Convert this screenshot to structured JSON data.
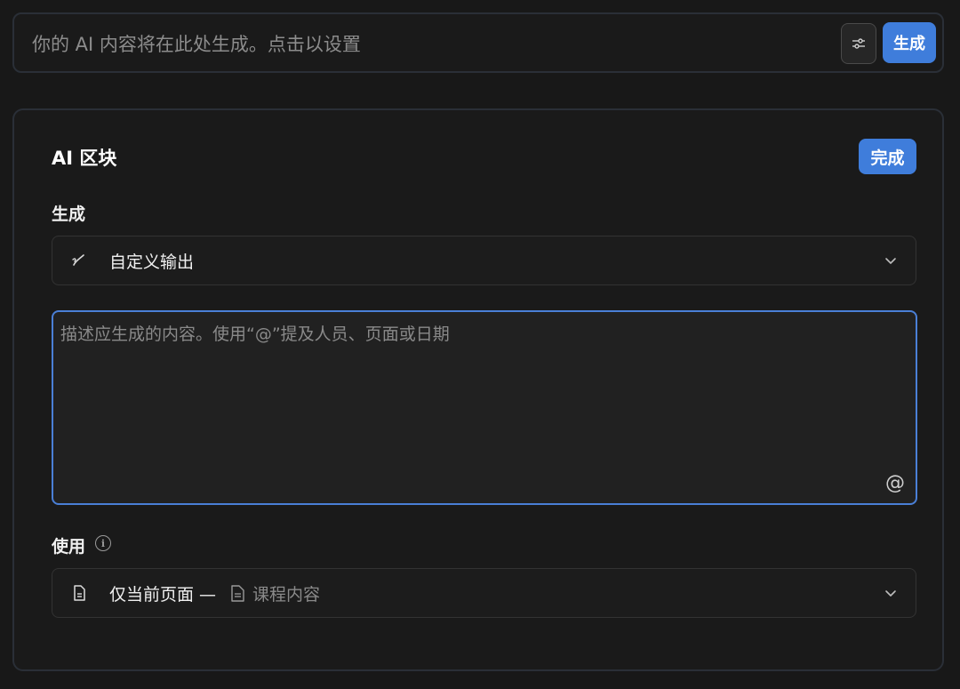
{
  "top": {
    "placeholder": "你的 AI 内容将在此处生成。点击以设置",
    "settings_icon": "sliders-icon",
    "generate_label": "生成"
  },
  "panel": {
    "title": "AI 区块",
    "done_label": "完成",
    "generate_section": {
      "label": "生成",
      "selected": "自定义输出",
      "icon": "pen-icon"
    },
    "prompt": {
      "placeholder": "描述应生成的内容。使用“@”提及人员、页面或日期",
      "at_symbol": "@"
    },
    "use_section": {
      "label": "使用",
      "info_icon": "info-icon",
      "selected": "仅当前页面 —",
      "source_page": "课程内容"
    }
  },
  "colors": {
    "background": "#181818",
    "accent": "#3f7ddb",
    "focus_border": "#4a7fd6"
  }
}
